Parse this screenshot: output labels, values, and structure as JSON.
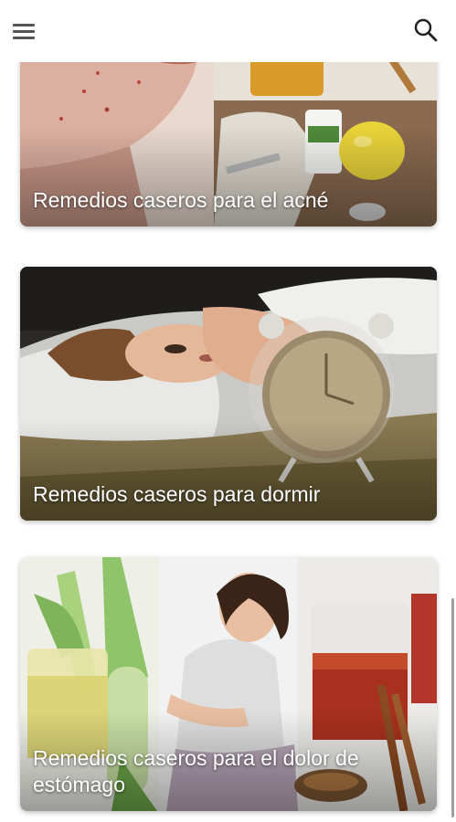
{
  "appbar": {
    "menu_icon": "hamburger-menu-icon",
    "search_icon": "search-icon"
  },
  "cards": [
    {
      "title": "Remedios caseros para el acné"
    },
    {
      "title": "Remedios caseros para dormir"
    },
    {
      "title": "Remedios caseros para el dolor de estómago"
    }
  ],
  "colors": {
    "icon": "#555555",
    "title_text": "#ffffff",
    "scrollbar": "#9e9e9e"
  }
}
